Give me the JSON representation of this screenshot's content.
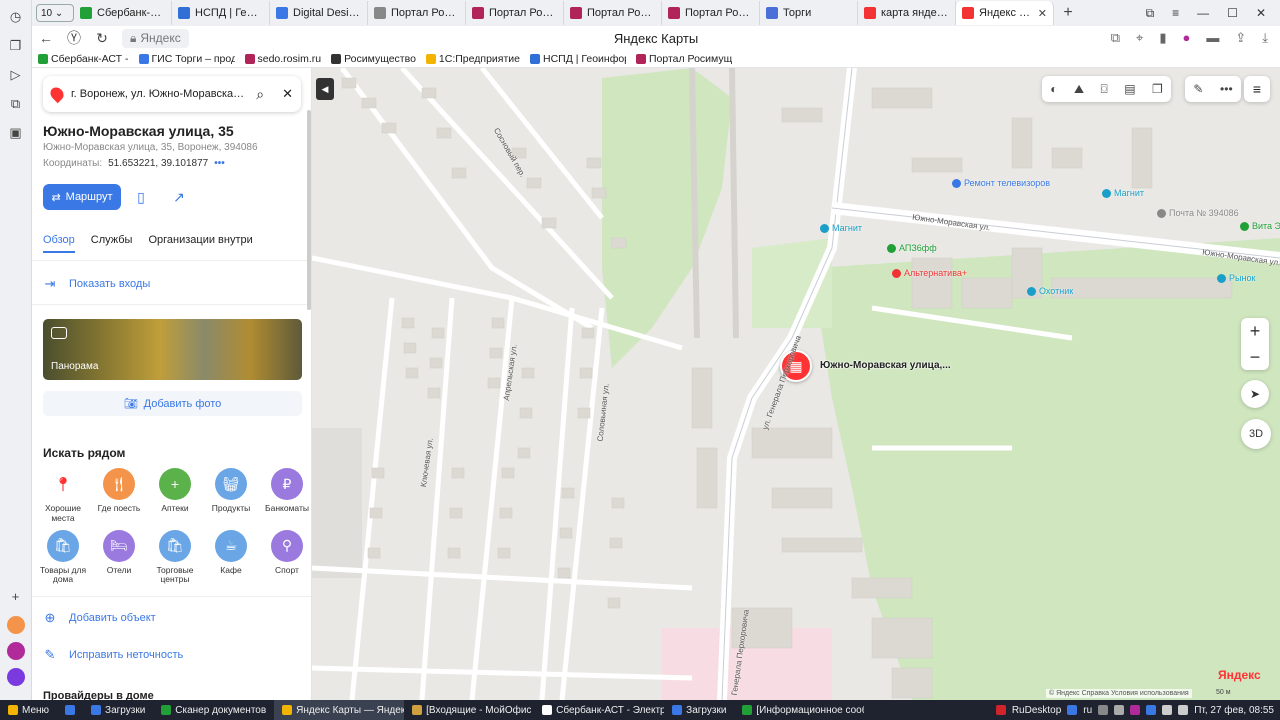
{
  "browser": {
    "tab_count": "10",
    "tabs": [
      {
        "label": "Сбербанк-АСТ -",
        "color": "#21a038",
        "active": false
      },
      {
        "label": "НСПД | Геоинфо",
        "color": "#2f6fd6",
        "active": false
      },
      {
        "label": "Digital Design We",
        "color": "#3a78e6",
        "active": false
      },
      {
        "label": "Портал Росимущ",
        "color": "#888888",
        "active": false
      },
      {
        "label": "Портал Росимущ",
        "color": "#b0245a",
        "active": false
      },
      {
        "label": "Портал Росимущ",
        "color": "#b0245a",
        "active": false
      },
      {
        "label": "Портал Росимущ",
        "color": "#b0245a",
        "active": false
      },
      {
        "label": "Торги",
        "color": "#4a6fd8",
        "active": false
      },
      {
        "label": "карта яндекс — ",
        "color": "#f33333",
        "active": false
      },
      {
        "label": "Яндекс Карты",
        "color": "#f33333",
        "active": true
      }
    ],
    "url_text": "Яндекс",
    "page_title": "Яндекс Карты",
    "bookmarks": [
      {
        "label": "Сбербанк-АСТ -",
        "color": "#21a038"
      },
      {
        "label": "ГИС Торги – прод",
        "color": "#3a78e6"
      },
      {
        "label": "sedo.rosim.ru",
        "color": "#b0245a"
      },
      {
        "label": "Росимущество",
        "color": "#333333"
      },
      {
        "label": "1С:Предприятие",
        "color": "#f2b400"
      },
      {
        "label": "НСПД | Геоинфор",
        "color": "#2f6fd6"
      },
      {
        "label": "Портал Росимущ",
        "color": "#b0245a"
      }
    ]
  },
  "sidebar": {
    "search_value": "г. Воронеж, ул. Южно-Моравская, д.",
    "title": "Южно-Моравская улица, 35",
    "address": "Южно-Моравская улица, 35, Воронеж, 394086",
    "coords_label": "Координаты:",
    "coords_value": "51.653221, 39.101877",
    "coords_more": "•••",
    "route_label": "Маршрут",
    "tabs": [
      "Обзор",
      "Службы",
      "Организации внутри"
    ],
    "show_entrances": "Показать входы",
    "panorama_label": "Панорама",
    "add_photo": "Добавить фото",
    "nearby_heading": "Искать рядом",
    "nearby": [
      {
        "label": "Хорошие места",
        "color": "#ffffff",
        "icon": "pin-icon"
      },
      {
        "label": "Где поесть",
        "color": "#f4944a",
        "icon": "food-icon"
      },
      {
        "label": "Аптеки",
        "color": "#5cb24a",
        "icon": "plus-icon"
      },
      {
        "label": "Продукты",
        "color": "#6aa6e6",
        "icon": "basket-icon"
      },
      {
        "label": "Банкоматы",
        "color": "#9b7ae0",
        "icon": "ruble-icon"
      },
      {
        "label": "Товары для дома",
        "color": "#6aa6e6",
        "icon": "bag-icon"
      },
      {
        "label": "Отели",
        "color": "#9b7ae0",
        "icon": "bed-icon"
      },
      {
        "label": "Торговые центры",
        "color": "#6aa6e6",
        "icon": "bag-icon"
      },
      {
        "label": "Кафе",
        "color": "#6aa6e6",
        "icon": "cup-icon"
      },
      {
        "label": "Спорт",
        "color": "#9b7ae0",
        "icon": "dumbbell-icon"
      }
    ],
    "add_object": "Добавить объект",
    "fix_error": "Исправить неточность",
    "providers": "Провайдеры в доме"
  },
  "map": {
    "marker_label": "Южно-Моравская улица,...",
    "pois": [
      {
        "label": "Ремонт телевизоров",
        "color": "#3a78e6"
      },
      {
        "label": "Магнит",
        "color": "#1aa0c8"
      },
      {
        "label": "Почта № 394086",
        "color": "#888888"
      },
      {
        "label": "Вита Эк",
        "color": "#21a038"
      },
      {
        "label": "Магнит",
        "color": "#1aa0c8"
      },
      {
        "label": "АПЗ6фф",
        "color": "#21a038"
      },
      {
        "label": "Альтернатива+",
        "color": "#f33333"
      },
      {
        "label": "Охотник",
        "color": "#1aa0c8"
      },
      {
        "label": "Рынок",
        "color": "#1aa0c8"
      }
    ],
    "streets": [
      "Южно-Моравская ул.",
      "Южно-Моравская ул.",
      "ул. Генерала Перхоровича",
      "Генерала Перхоровича",
      "Апрельская ул.",
      "Ключевая ул.",
      "Соловьиная ул.",
      "Сосновый пер."
    ],
    "zoom_in": "+",
    "zoom_out": "−",
    "three_d": "3D",
    "logo": "Яндекс",
    "copyright": "© Яндекс  Справка  Условия использования",
    "scale": "50 м"
  },
  "taskbar": {
    "menu": "Меню",
    "items": [
      {
        "label": "Загрузки",
        "color": "#3a78e6",
        "active": false
      },
      {
        "label": "Сканер документов",
        "color": "#21a038",
        "active": false
      },
      {
        "label": "Яндекс Карты — Яндекс ...",
        "color": "#f2b400",
        "active": true
      },
      {
        "label": "[Входящие - МойОфис П...",
        "color": "#d0a040",
        "active": false
      },
      {
        "label": "Сбербанк-АСТ - Электро...",
        "color": "#ffffff",
        "active": false
      },
      {
        "label": "Загрузки",
        "color": "#3a78e6",
        "active": false
      },
      {
        "label": "[Информационное сооб...",
        "color": "#21a038",
        "active": false
      }
    ],
    "rudesktop": "RuDesktop",
    "lang": "ru",
    "clock": "Пт, 27 фев, 08:55"
  }
}
